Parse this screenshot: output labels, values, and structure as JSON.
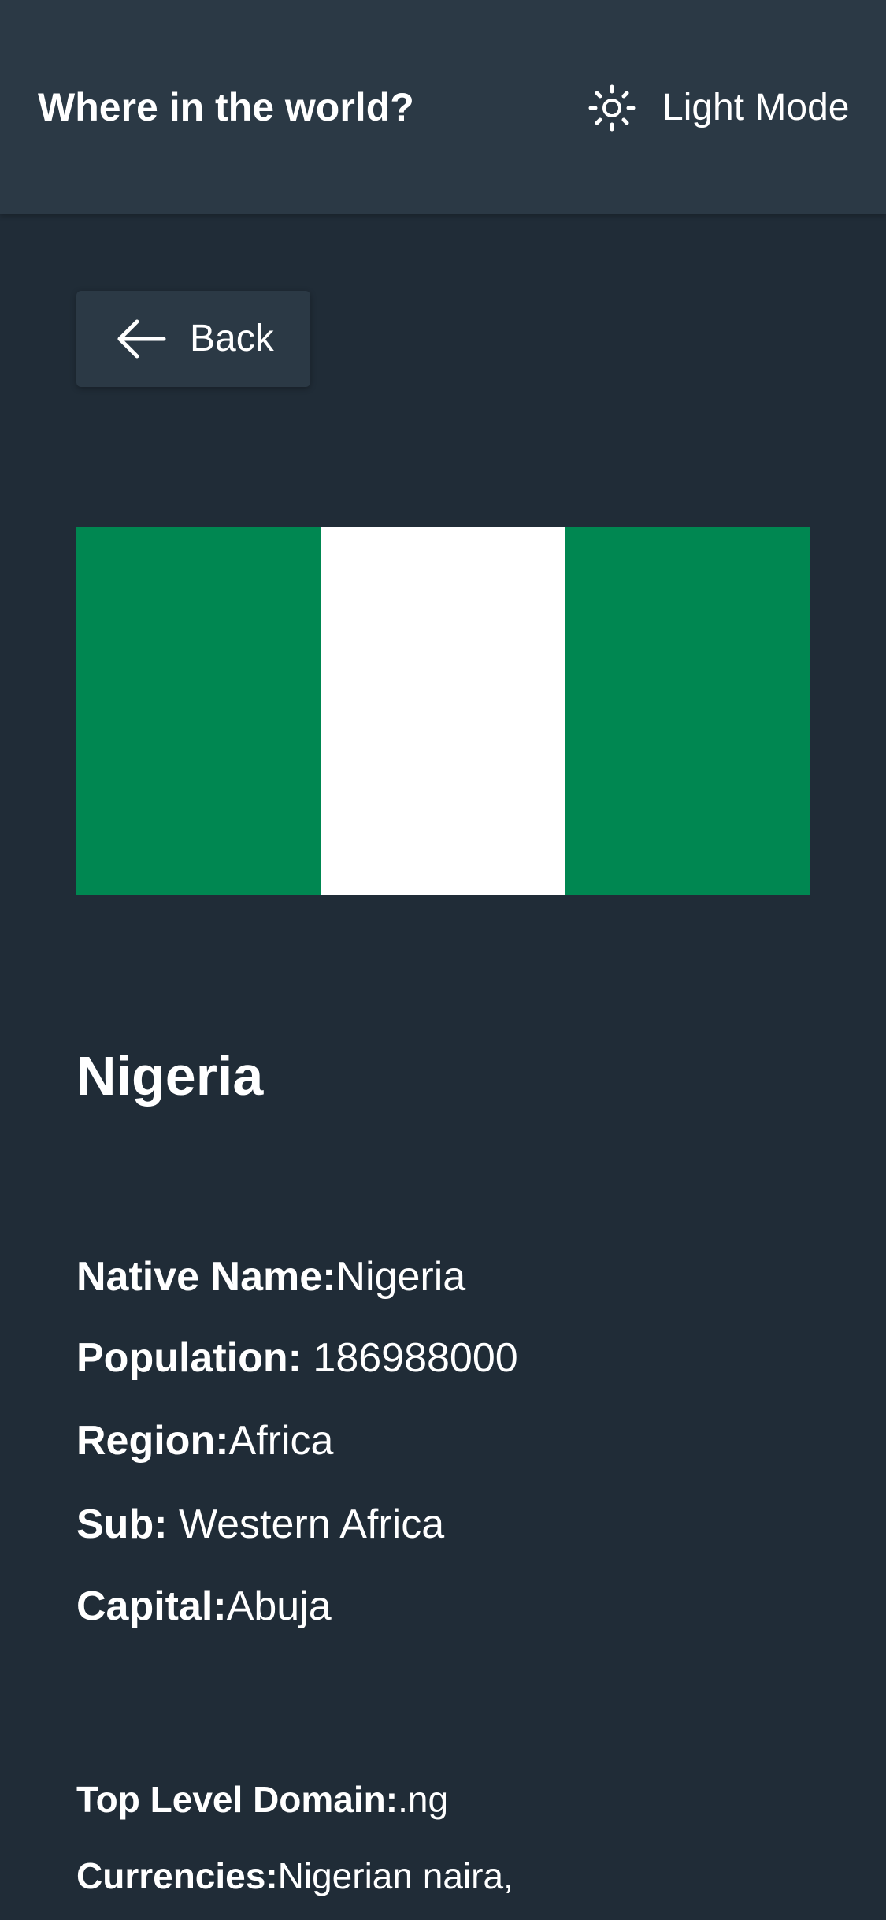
{
  "header": {
    "title": "Where in the world?",
    "mode_label": "Light Mode",
    "mode_icon": "sun-icon"
  },
  "back": {
    "label": "Back",
    "icon": "arrow-left-icon"
  },
  "country": {
    "name": "Nigeria",
    "flag_colors": [
      "#008751",
      "#ffffff",
      "#008751"
    ],
    "details": [
      {
        "label": "Native Name:",
        "value": "Nigeria"
      },
      {
        "label": "Population:",
        "value": " 186988000"
      },
      {
        "label": "Region:",
        "value": "Africa"
      },
      {
        "label": "Sub:",
        "value": " Western Africa"
      },
      {
        "label": "Capital:",
        "value": "Abuja"
      }
    ],
    "extra": [
      {
        "label": "Top Level Domain:",
        "value": ".ng"
      },
      {
        "label": "Currencies:",
        "value": "Nigerian naira,"
      }
    ]
  },
  "colors": {
    "background": "#202c37",
    "elements": "#2b3945",
    "text": "#ffffff"
  }
}
